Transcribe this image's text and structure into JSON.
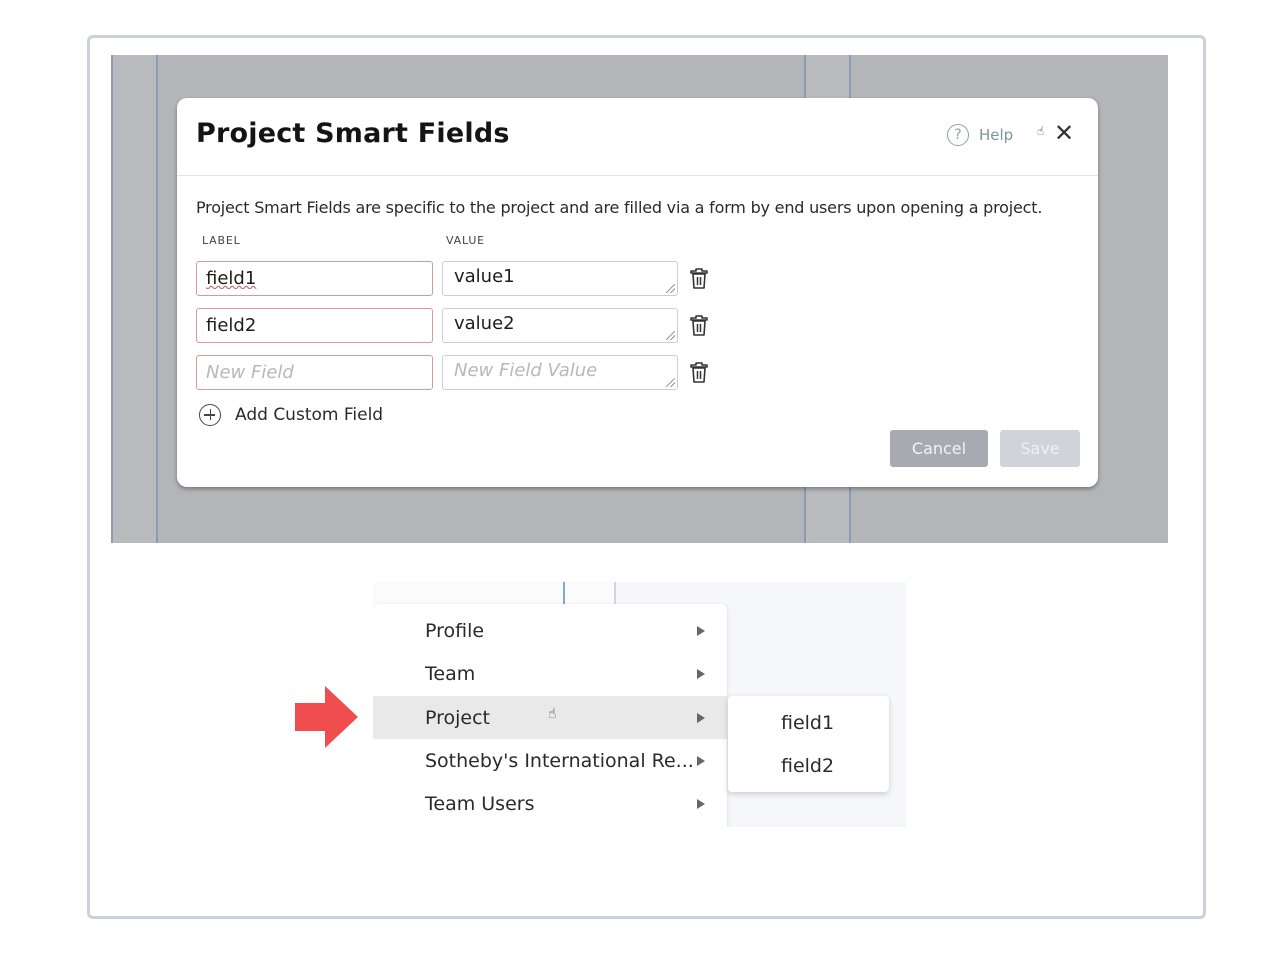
{
  "modal": {
    "title": "Project Smart Fields",
    "help_label": "Help",
    "description": "Project Smart Fields are specific to the project and are filled via a form by end users upon opening a project.",
    "columns": {
      "label": "LABEL",
      "value": "VALUE"
    },
    "rows": [
      {
        "label": "field1",
        "value": "value1",
        "label_placeholder": "New Field",
        "value_placeholder": "New Field Value"
      },
      {
        "label": "field2",
        "value": "value2",
        "label_placeholder": "New Field",
        "value_placeholder": "New Field Value"
      },
      {
        "label": "",
        "value": "",
        "label_placeholder": "New Field",
        "value_placeholder": "New Field Value"
      }
    ],
    "add_label": "Add Custom Field",
    "cancel_label": "Cancel",
    "save_label": "Save"
  },
  "menu": {
    "items": [
      {
        "label": "Profile"
      },
      {
        "label": "Team"
      },
      {
        "label": "Project",
        "active": true
      },
      {
        "label": "Sotheby's International Re..."
      },
      {
        "label": "Team Users"
      }
    ],
    "submenu": [
      {
        "label": "field1"
      },
      {
        "label": "field2"
      }
    ]
  },
  "colors": {
    "annotation_arrow": "#f04e4e",
    "label_border": "#d79a98",
    "cancel_bg": "#a7abb1",
    "save_bg": "#d0d4da",
    "active_menu_bg": "#e9e9ea"
  }
}
